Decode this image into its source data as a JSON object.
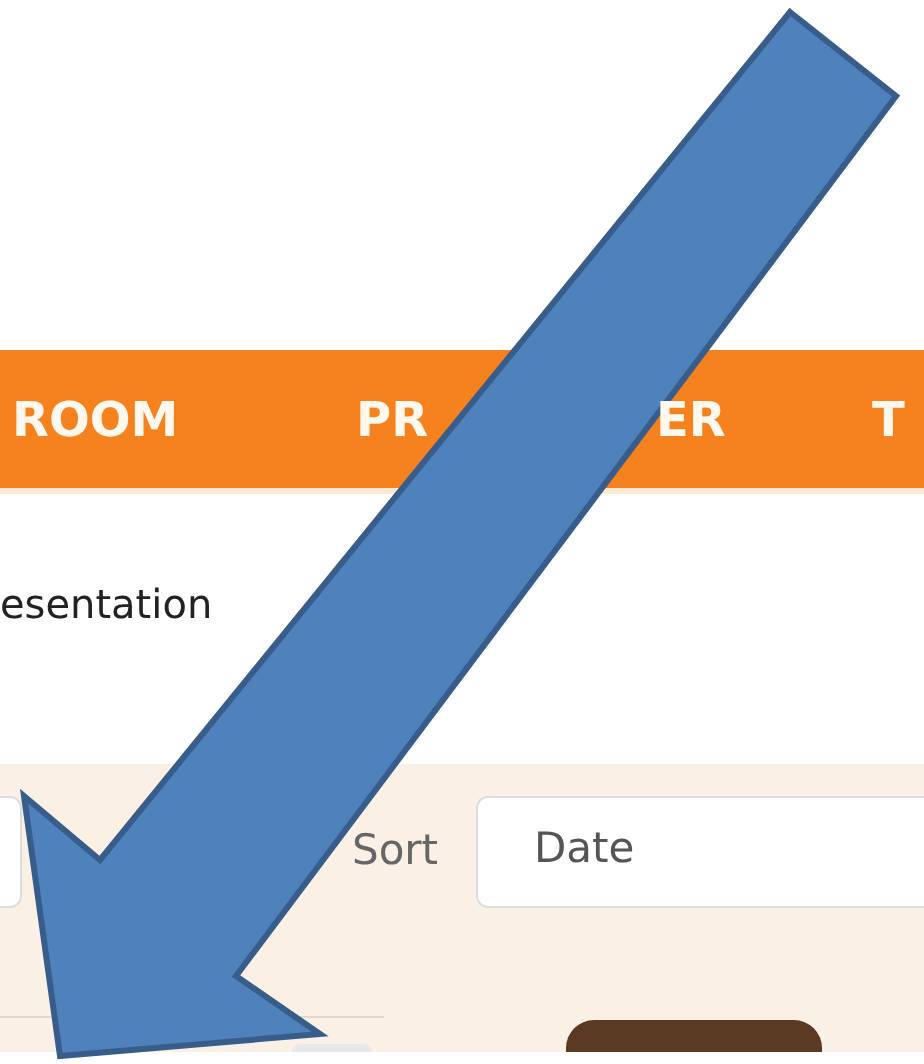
{
  "nav": {
    "items": [
      {
        "parts": [
          "ROOM"
        ]
      },
      {
        "parts": [
          "PR",
          "ER"
        ]
      },
      {
        "parts": [
          "T"
        ]
      }
    ]
  },
  "breadcrumb": "esentation",
  "toolbar": {
    "sort_label": "Sort",
    "sort_value": "Date"
  },
  "overlay": {
    "kind": "arrow"
  }
}
